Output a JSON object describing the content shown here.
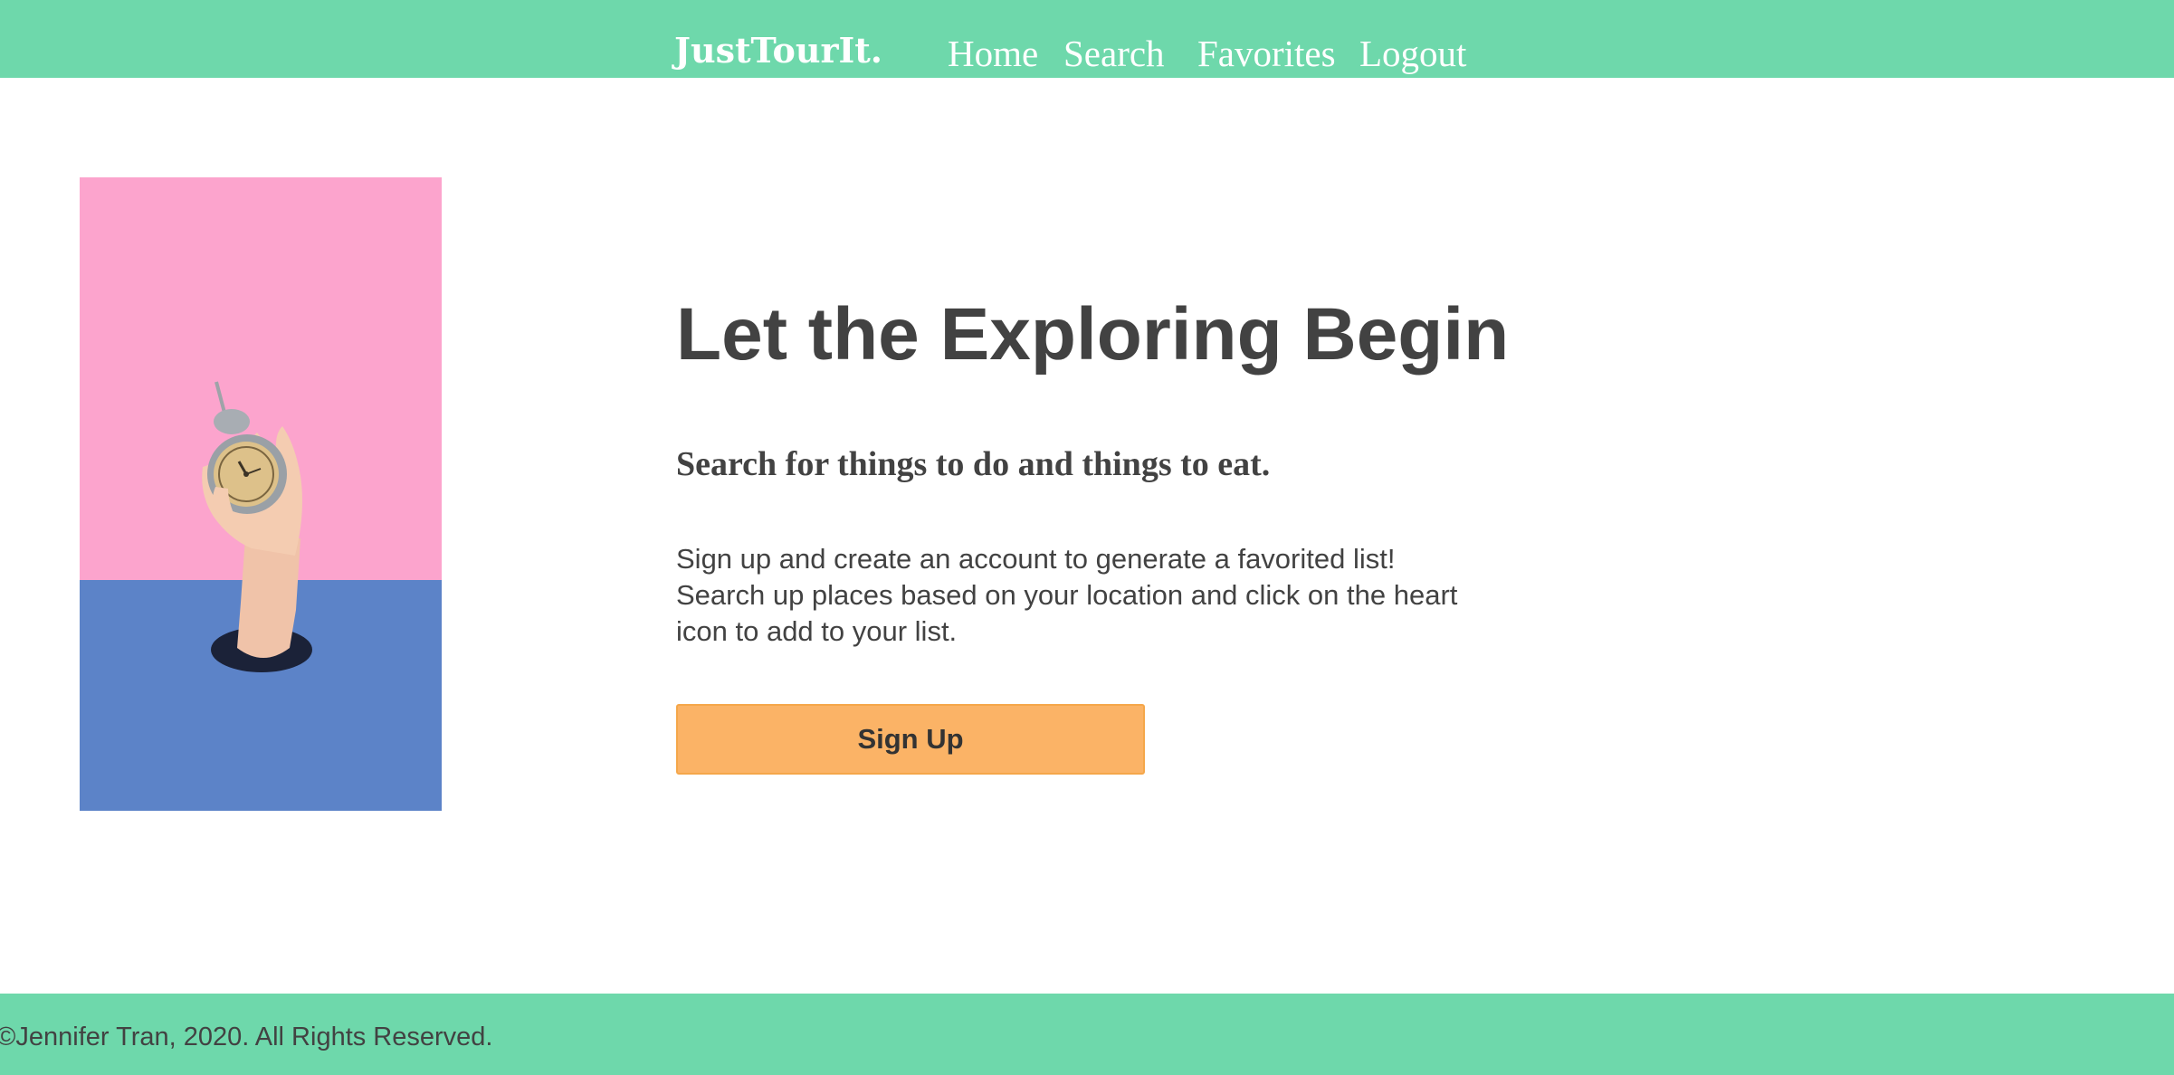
{
  "nav": {
    "brand": "JustTourIt.",
    "items": [
      {
        "label": "Home"
      },
      {
        "label": "Search"
      },
      {
        "label": "Favorites"
      },
      {
        "label": "Logout"
      }
    ]
  },
  "hero": {
    "title": "Let the Exploring Begin",
    "subtitle": "Search for things to do and things to eat.",
    "description": "Sign up and create an account to generate a favorited list! Search up places based on your location and click on the heart icon to add to your list.",
    "button_label": "Sign Up"
  },
  "footer": {
    "text": "©Jennifer Tran, 2020. All Rights Reserved."
  },
  "colors": {
    "nav_background": "#6ed8ab",
    "button_background": "#fbb366",
    "text": "#424242",
    "image_top": "#fca4cd",
    "image_bottom": "#5c83c8"
  },
  "icons": {
    "hero_image": "hand-holding-alarm-clock-illustration"
  }
}
